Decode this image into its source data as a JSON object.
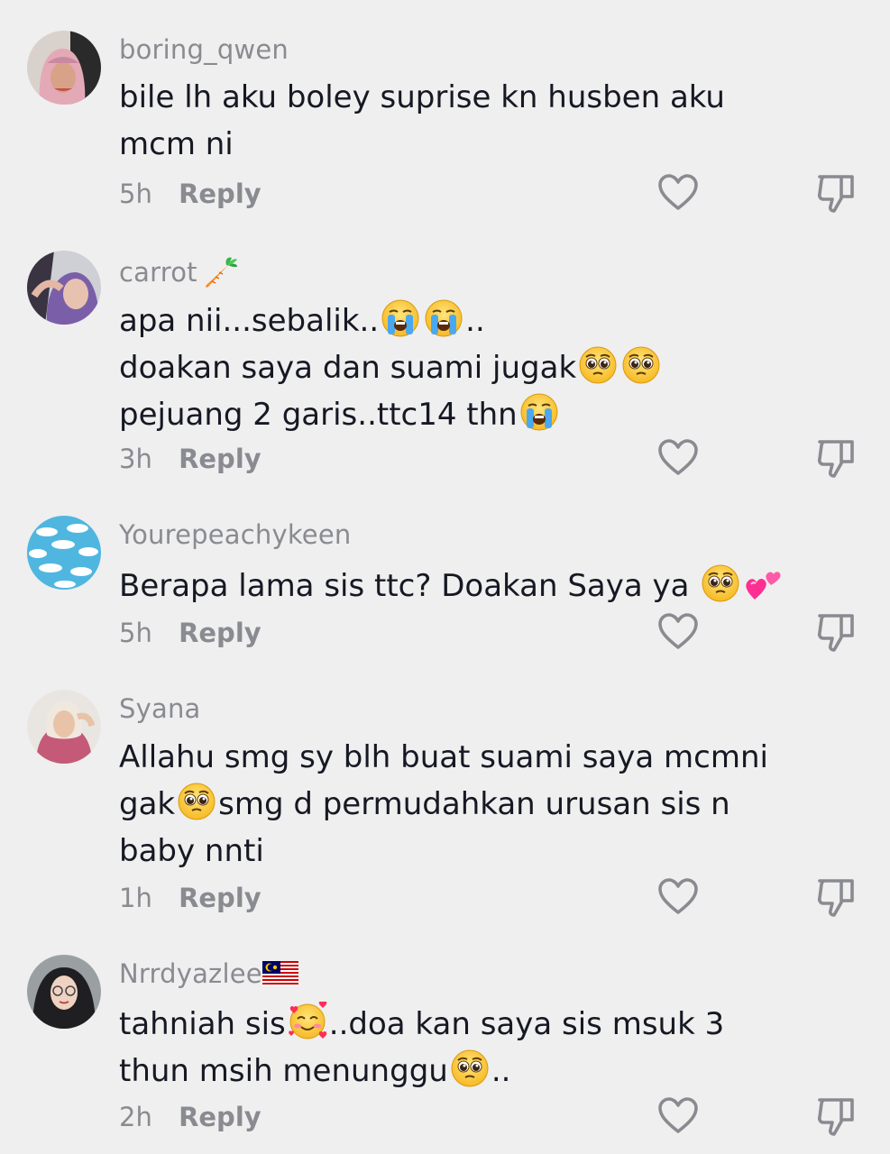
{
  "comments": [
    {
      "username": "boring_qwen",
      "lines": [
        "bile lh aku boley suprise kn husben aku",
        "mcm ni"
      ],
      "time": "5h",
      "reply_label": "Reply"
    },
    {
      "username": "carrot",
      "username_emoji": "carrot",
      "lines": [
        "apa nii...sebalik..",
        "doakan saya dan suami jugak",
        "pejuang 2 garis..ttc14 thn"
      ],
      "time": "3h",
      "reply_label": "Reply"
    },
    {
      "username": "Yourepeachykeen",
      "lines": [
        "Berapa lama sis ttc? Doakan Saya ya "
      ],
      "time": "5h",
      "reply_label": "Reply"
    },
    {
      "username": "Syana",
      "lines": [
        "Allahu smg sy blh buat suami saya mcmni",
        "gak",
        "smg d permudahkan urusan sis n",
        "baby nnti"
      ],
      "time": "1h",
      "reply_label": "Reply"
    },
    {
      "username": "Nrrdyazlee",
      "username_emoji": "malaysia-flag",
      "lines": [
        "tahniah sis",
        "..doa kan saya sis msuk 3",
        "thun msih menunggu",
        ".."
      ],
      "time": "2h",
      "reply_label": "Reply"
    }
  ],
  "emoji_names": {
    "loudly-crying": "loudly-crying-face-emoji",
    "pleading": "pleading-face-emoji",
    "two-hearts": "two-hearts-emoji",
    "smiling-hearts": "smiling-face-with-hearts-emoji"
  },
  "colors": {
    "background": "#efefef",
    "username": "#8a8b91",
    "text": "#161823",
    "icon": "#8a8b91"
  }
}
